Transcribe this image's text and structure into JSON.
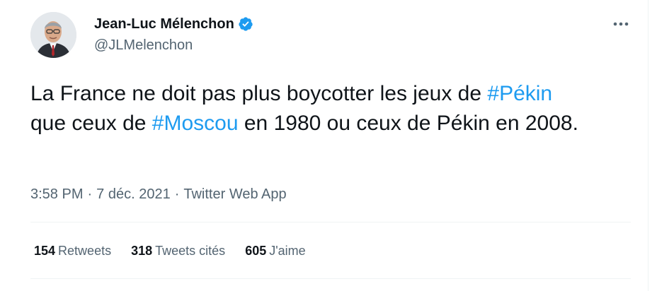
{
  "author": {
    "display_name": "Jean-Luc Mélenchon",
    "handle": "@JLMelenchon",
    "verified": true,
    "verified_color": "#1d9bf0"
  },
  "tweet": {
    "line1_text": "La France ne doit pas plus boycotter les jeux de ",
    "hashtag1": "#Pékin",
    "line2_text": "que ceux de ",
    "hashtag2": "#Moscou",
    "rest_text": " en 1980 ou ceux de Pékin en 2008."
  },
  "meta": {
    "time": "3:58 PM",
    "separator1": "·",
    "date": "7 déc. 2021",
    "separator2": "·",
    "source": "Twitter Web App"
  },
  "stats": {
    "retweets_count": "154",
    "retweets_label": "Retweets",
    "quotes_count": "318",
    "quotes_label": "Tweets cités",
    "likes_count": "605",
    "likes_label": "J'aime"
  },
  "icons": {
    "more": "more-options-icon",
    "verified": "verified-badge-icon"
  },
  "colors": {
    "link": "#1d9bf0",
    "secondary_text": "#536471",
    "primary_text": "#0f1419"
  }
}
